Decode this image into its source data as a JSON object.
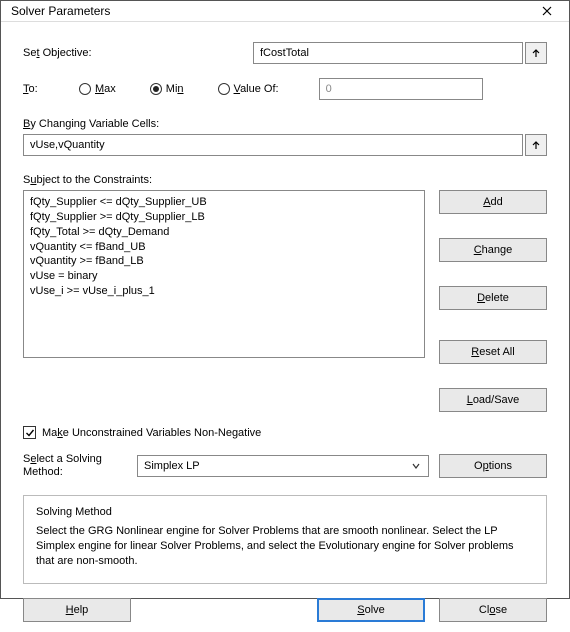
{
  "window": {
    "title": "Solver Parameters"
  },
  "objective": {
    "label_pre": "Se",
    "label_key": "t",
    "label_post": " Objective:",
    "value": "fCostTotal"
  },
  "to": {
    "label_pre": "",
    "label_key": "T",
    "label_post": "o:",
    "max_key": "M",
    "max_post": "ax",
    "min_pre": "Mi",
    "min_key": "n",
    "min_post": "",
    "valueof_key": "V",
    "valueof_post": "alue Of:",
    "selected": "min",
    "value_text": "0"
  },
  "changing": {
    "label_key": "B",
    "label_post": "y Changing Variable Cells:",
    "value": "vUse,vQuantity"
  },
  "constraints": {
    "label_pre": "S",
    "label_key": "u",
    "label_post": "bject to the Constraints:",
    "items": [
      "fQty_Supplier <= dQty_Supplier_UB",
      "fQty_Supplier >= dQty_Supplier_LB",
      "fQty_Total >= dQty_Demand",
      "vQuantity <= fBand_UB",
      "vQuantity >= fBand_LB",
      "vUse = binary",
      "vUse_i >= vUse_i_plus_1"
    ]
  },
  "buttons": {
    "add_key": "A",
    "add_post": "dd",
    "change_key": "C",
    "change_post": "hange",
    "delete_key": "D",
    "delete_post": "elete",
    "reset_key": "R",
    "reset_post": "eset All",
    "loadsave_key": "L",
    "loadsave_post": "oad/Save",
    "options_pre": "O",
    "options_key": "p",
    "options_post": "tions",
    "help_key": "H",
    "help_post": "elp",
    "solve_key": "S",
    "solve_post": "olve",
    "close_pre": "Cl",
    "close_key": "o",
    "close_post": "se"
  },
  "checkbox": {
    "checked": true,
    "label_pre": "Ma",
    "label_key": "k",
    "label_post": "e Unconstrained Variables Non-Negative"
  },
  "method": {
    "label_pre": "S",
    "label_key": "e",
    "label_post": "lect a Solving Method:",
    "selected": "Simplex LP"
  },
  "info": {
    "title": "Solving Method",
    "text": "Select the GRG Nonlinear engine for Solver Problems that are smooth nonlinear. Select the LP Simplex engine for linear Solver Problems, and select the Evolutionary engine for Solver problems that are non-smooth."
  }
}
